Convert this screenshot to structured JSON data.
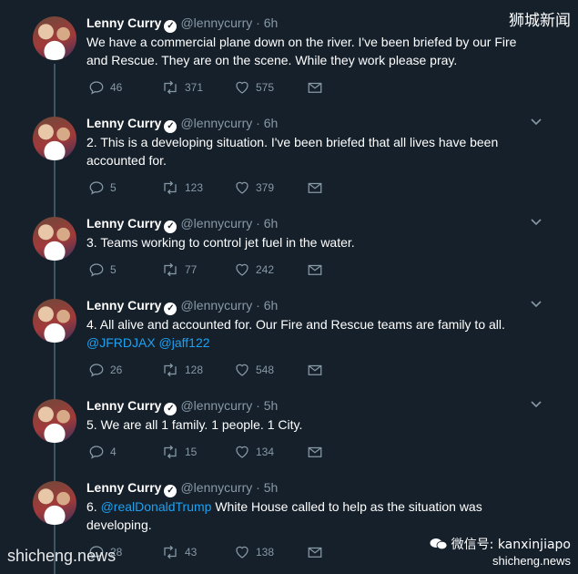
{
  "author": {
    "name": "Lenny Curry",
    "handle": "@lennycurry"
  },
  "tweets": [
    {
      "time": "6h",
      "text": "We have a commercial plane down on the river.  I've been briefed by our Fire and Rescue. They are on the scene.  While they work please pray.",
      "replies": "46",
      "retweets": "371",
      "likes": "575"
    },
    {
      "time": "6h",
      "text": "2. This is a developing situation. I've been briefed that all lives have been accounted for.",
      "replies": "5",
      "retweets": "123",
      "likes": "379"
    },
    {
      "time": "6h",
      "text": "3.  Teams working to control jet fuel in the water.",
      "replies": "5",
      "retweets": "77",
      "likes": "242"
    },
    {
      "time": "6h",
      "text": "4.  All alive and accounted for. Our Fire and Rescue teams are family to all.",
      "mentions": "@JFRDJAX @jaff122",
      "replies": "26",
      "retweets": "128",
      "likes": "548"
    },
    {
      "time": "5h",
      "text": "5. We are all 1 family. 1 people. 1 City.",
      "replies": "4",
      "retweets": "15",
      "likes": "134"
    },
    {
      "time": "5h",
      "text_prefix": "6. ",
      "mention": "@realDonaldTrump",
      "text_suffix": " White House called to help as the situation was developing.",
      "replies": "28",
      "retweets": "43",
      "likes": "138"
    }
  ],
  "watermarks": {
    "top_right": "狮城新闻",
    "bottom_left": "shicheng.news",
    "wechat": "微信号: kanxinjiapo",
    "bottom_right": "shicheng.news"
  }
}
